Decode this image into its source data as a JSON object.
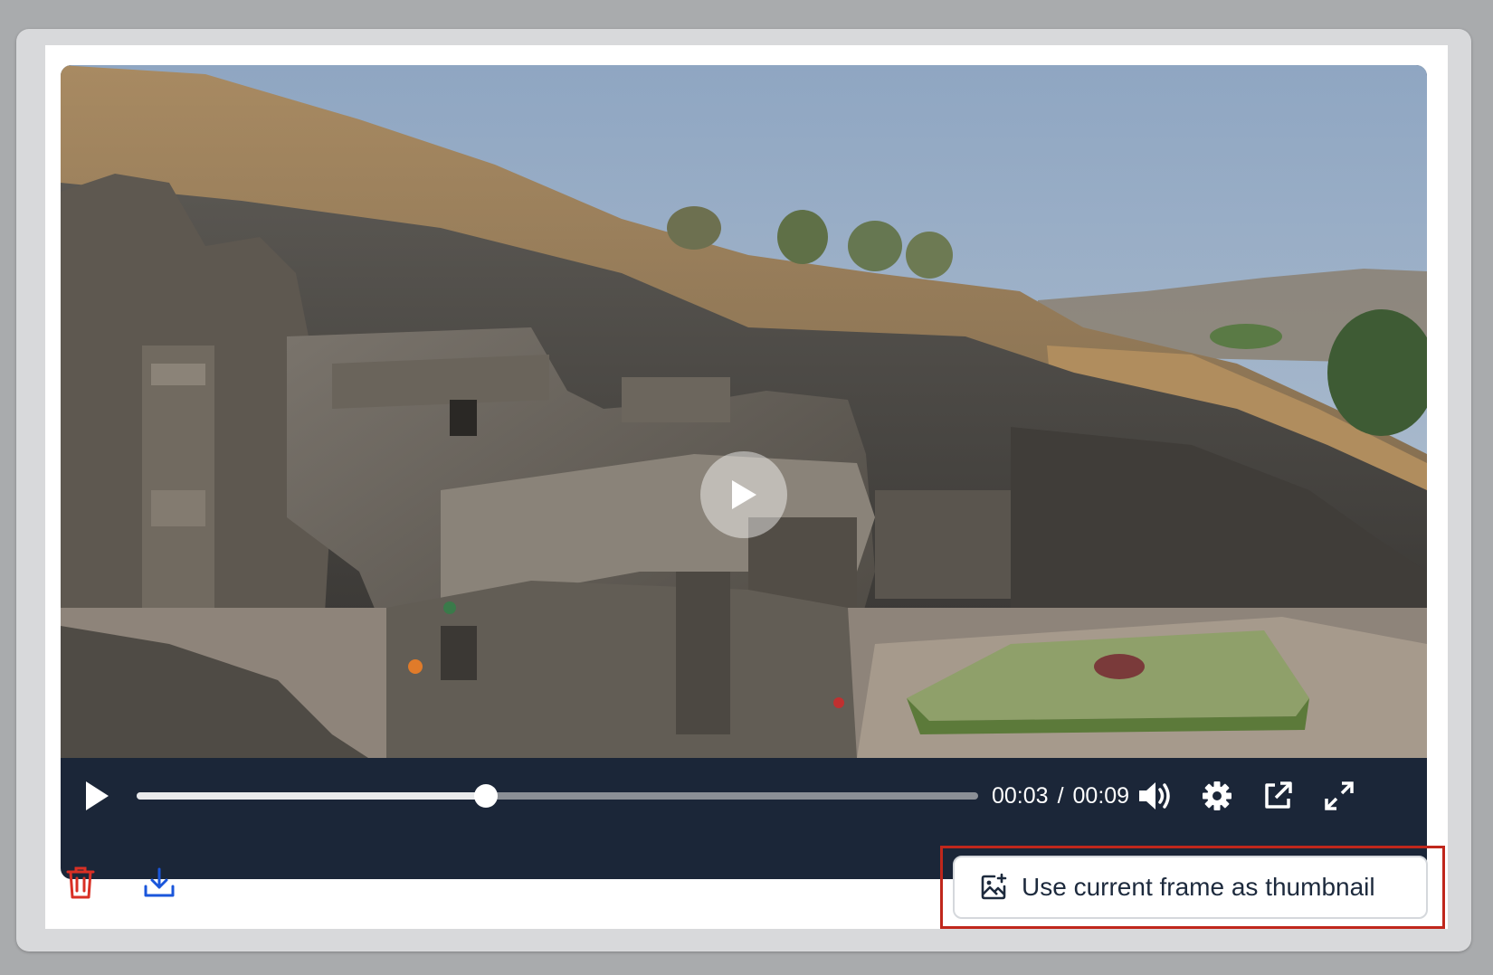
{
  "player": {
    "current_time": "00:03",
    "time_separator": "/",
    "duration": "00:09",
    "progress_fraction": 0.415,
    "play_icon": "play-icon",
    "volume_icon": "volume-icon",
    "settings_icon": "gear-icon",
    "popout_icon": "external-link-icon",
    "fullscreen_icon": "fullscreen-icon"
  },
  "actions": {
    "delete_icon": "trash-icon",
    "download_icon": "download-icon",
    "thumbnail_button_label": "Use current frame as thumbnail",
    "thumbnail_icon": "image-plus-icon"
  },
  "colors": {
    "control_bar": "#1b2638",
    "delete": "#d93025",
    "download": "#1a56db",
    "highlight": "#c0271c"
  }
}
